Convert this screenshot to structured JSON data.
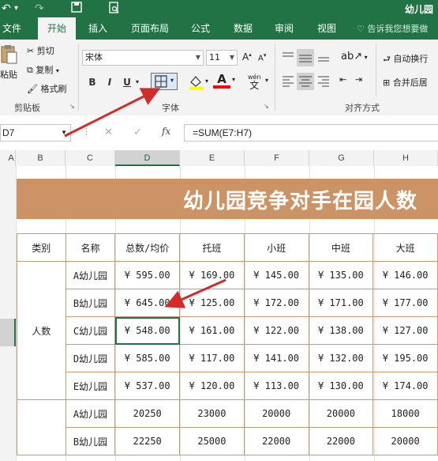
{
  "titlebar": {
    "doc_title": "幼儿园",
    "undo_icon": "undo-icon",
    "redo_icon": "redo-icon",
    "save_icon": "save-icon",
    "preview_icon": "print-preview-icon"
  },
  "tabs": [
    {
      "label": "文件",
      "active": false
    },
    {
      "label": "开始",
      "active": true
    },
    {
      "label": "插入",
      "active": false
    },
    {
      "label": "页面布局",
      "active": false
    },
    {
      "label": "公式",
      "active": false
    },
    {
      "label": "数据",
      "active": false
    },
    {
      "label": "审阅",
      "active": false
    },
    {
      "label": "视图",
      "active": false
    }
  ],
  "tell_me": "告诉我您想要做",
  "ribbon": {
    "clipboard": {
      "paste": "粘贴",
      "cut": "剪切",
      "copy": "复制",
      "format_painter": "格式刷",
      "group": "剪贴板"
    },
    "font": {
      "name": "宋体",
      "size": "11",
      "group": "字体",
      "bold": "B",
      "italic": "I",
      "underline": "U",
      "wen": "wén",
      "wen_char": "文"
    },
    "align": {
      "wrap": "自动换行",
      "merge": "合并后居",
      "group": "对齐方式"
    }
  },
  "formula_bar": {
    "name_box": "D7",
    "fx": "fx",
    "formula": "=SUM(E7:H7)"
  },
  "columns": [
    "A",
    "B",
    "C",
    "D",
    "E",
    "F",
    "G",
    "H"
  ],
  "selected_column": "D",
  "banner_title": "幼儿园竞争对手在园人数",
  "table": {
    "headers": [
      "类别",
      "名称",
      "总数/均价",
      "托班",
      "小班",
      "中班",
      "大班"
    ],
    "group1_label": "人数",
    "rows": [
      [
        "A幼儿园",
        "¥ 595.00",
        "¥ 169.00",
        "¥ 145.00",
        "¥ 135.00",
        "¥ 146.00"
      ],
      [
        "B幼儿园",
        "¥ 645.00",
        "¥ 125.00",
        "¥ 172.00",
        "¥ 171.00",
        "¥ 177.00"
      ],
      [
        "C幼儿园",
        "¥ 548.00",
        "¥ 161.00",
        "¥ 122.00",
        "¥ 138.00",
        "¥ 127.00"
      ],
      [
        "D幼儿园",
        "¥ 585.00",
        "¥ 117.00",
        "¥ 141.00",
        "¥ 132.00",
        "¥ 195.00"
      ],
      [
        "E幼儿园",
        "¥ 537.00",
        "¥ 120.00",
        "¥ 113.00",
        "¥ 130.00",
        "¥ 174.00"
      ],
      [
        "A幼儿园",
        "20250",
        "23000",
        "20000",
        "20000",
        "18000"
      ],
      [
        "B幼儿园",
        "22250",
        "25000",
        "22000",
        "22000",
        "20000"
      ]
    ]
  },
  "colors": {
    "excel_green": "#217346",
    "banner": "#cc9466",
    "arrow": "#d42a2a"
  }
}
